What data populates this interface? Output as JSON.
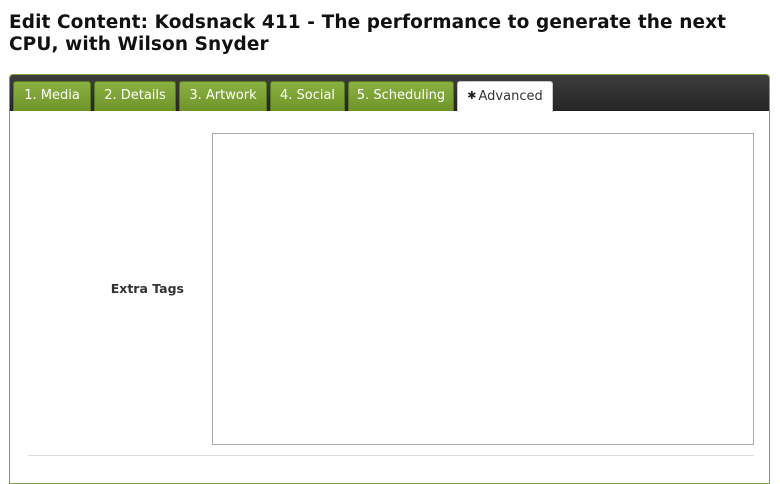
{
  "page": {
    "title": "Edit Content: Kodsnack 411 - The performance to generate the next CPU, with Wilson Snyder"
  },
  "tabs": [
    {
      "label": "1. Media",
      "active": false
    },
    {
      "label": "2. Details",
      "active": false
    },
    {
      "label": "3. Artwork",
      "active": false
    },
    {
      "label": "4. Social",
      "active": false
    },
    {
      "label": "5. Scheduling",
      "active": false
    },
    {
      "label": "Advanced",
      "active": true,
      "icon": "gear-icon"
    }
  ],
  "advanced": {
    "extra_tags_label": "Extra Tags",
    "extra_tags_value": ""
  },
  "colors": {
    "tab_green": "#7aa234",
    "tab_bar_dark": "#303030",
    "panel_border": "#7ea33a"
  }
}
